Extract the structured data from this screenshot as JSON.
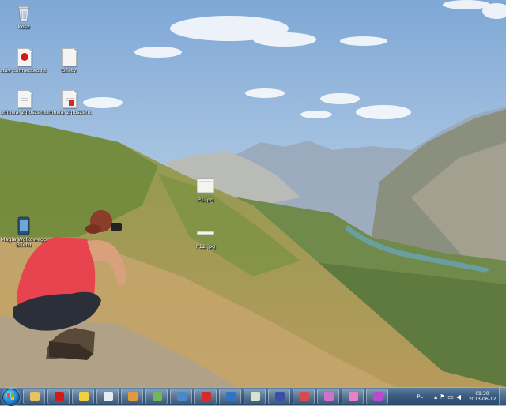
{
  "desktop": {
    "icons": [
      {
        "label": "Kosz",
        "icon": "recycle-bin-icon"
      },
      {
        "label": "stay connected.html",
        "icon": "html-document-icon"
      },
      {
        "label": "Bilety",
        "icon": "text-file-icon"
      },
      {
        "label": "umowa_zgloszeni...",
        "icon": "document-icon"
      },
      {
        "label": "umowa_zgloszeni...",
        "icon": "pdf-document-icon"
      },
      {
        "label": "P1.jpg",
        "icon": "image-file-icon"
      },
      {
        "label": "P12.jpg",
        "icon": "image-file-icon"
      },
      {
        "label": "Magia Wolkowego Biletu",
        "icon": "phone-image-icon"
      }
    ]
  },
  "taskbar": {
    "start": "start-button",
    "pinned": [
      {
        "name": "folder-icon",
        "color": "#e8c25a"
      },
      {
        "name": "opera-icon",
        "color": "#d01b1b"
      },
      {
        "name": "batman-icon",
        "color": "#f2d23c"
      },
      {
        "name": "notes-icon",
        "color": "#e6ecf2"
      },
      {
        "name": "tools-icon",
        "color": "#e39a3a"
      },
      {
        "name": "image-viewer-icon",
        "color": "#6fb85a"
      },
      {
        "name": "network-icon",
        "color": "#4a88c8"
      },
      {
        "name": "acrobat-icon",
        "color": "#d72a2a"
      },
      {
        "name": "help-icon",
        "color": "#2f74c9"
      },
      {
        "name": "document-viewer-icon",
        "color": "#d8e2d0"
      },
      {
        "name": "floppy-icon",
        "color": "#3a4fa8"
      },
      {
        "name": "calendar-date-icon",
        "color": "#d84a4a"
      },
      {
        "name": "paint-icon",
        "color": "#d570c8"
      },
      {
        "name": "cleaner-icon",
        "color": "#e783c2"
      },
      {
        "name": "pen-icon",
        "color": "#b84ad0"
      }
    ],
    "tray": {
      "language": "PL",
      "time": "09:30",
      "date": "2013-06-12"
    }
  }
}
